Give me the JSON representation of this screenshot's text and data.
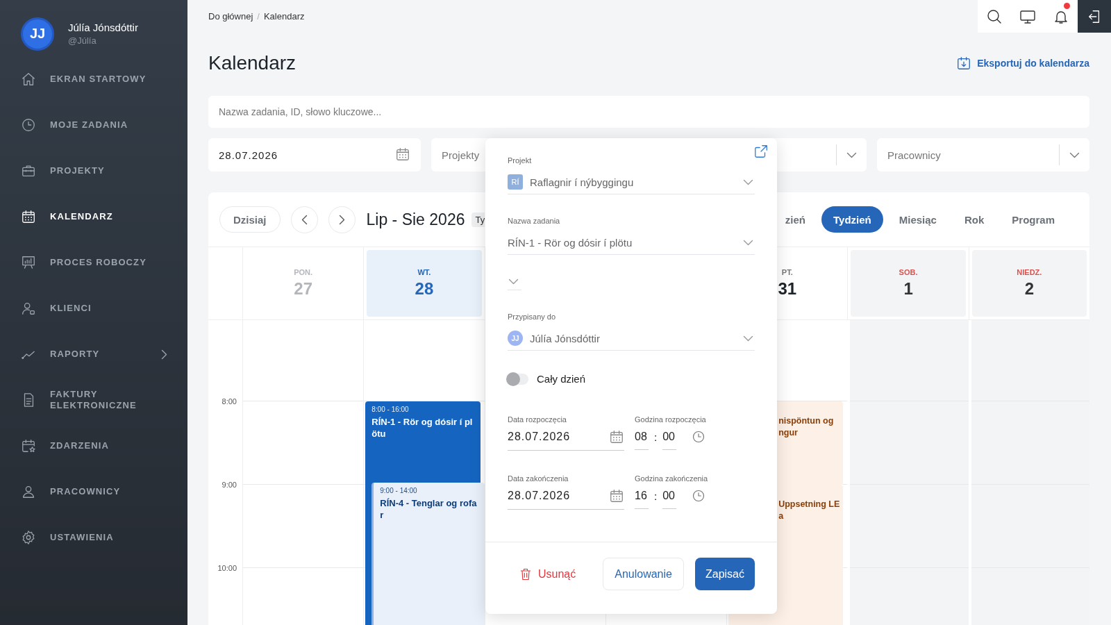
{
  "user": {
    "initials": "JJ",
    "name": "Júlía Jónsdóttir",
    "handle": "@Júlía"
  },
  "sidebar": {
    "items": [
      {
        "label": "EKRAN STARTOWY",
        "kind": "home",
        "selected": false,
        "has_submenu": false
      },
      {
        "label": "MOJE ZADANIA",
        "kind": "clock",
        "selected": false,
        "has_submenu": false
      },
      {
        "label": "PROJEKTY",
        "kind": "briefcase",
        "selected": false,
        "has_submenu": false
      },
      {
        "label": "KALENDARZ",
        "kind": "calendar",
        "selected": true,
        "has_submenu": false
      },
      {
        "label": "PROCES ROBOCZY",
        "kind": "board",
        "selected": false,
        "has_submenu": false
      },
      {
        "label": "KLIENCI",
        "kind": "client",
        "selected": false,
        "has_submenu": false
      },
      {
        "label": "RAPORTY",
        "kind": "chart",
        "selected": false,
        "has_submenu": true
      },
      {
        "label": "FAKTURY ELEKTRONICZNE",
        "kind": "document",
        "selected": false,
        "has_submenu": false
      },
      {
        "label": "ZDARZENIA",
        "kind": "event",
        "selected": false,
        "has_submenu": false
      },
      {
        "label": "PRACOWNICY",
        "kind": "people",
        "selected": false,
        "has_submenu": false
      },
      {
        "label": "USTAWIENIA",
        "kind": "gear",
        "selected": false,
        "has_submenu": false
      }
    ]
  },
  "breadcrumb": {
    "items": [
      "Do głównej",
      "Kalendarz"
    ],
    "separator": "/"
  },
  "topbar": {
    "notifications_unread": true
  },
  "page_title": "Kalendarz",
  "export_link": "Eksportuj do kalendarza",
  "search": {
    "placeholder": "Nazwa zadania, ID, słowo kluczowe..."
  },
  "filters": [
    {
      "kind": "date",
      "value": "28.07.2026"
    },
    {
      "kind": "label",
      "placeholder": "Projekty"
    },
    {
      "kind": "select"
    },
    {
      "kind": "select",
      "placeholder": "Pracownicy"
    }
  ],
  "calendar": {
    "today_button": "Dzisiaj",
    "range_title": "Lip - Sie 2026",
    "range_chip": "Ty",
    "views": [
      {
        "label": "zień",
        "selected": false
      },
      {
        "label": "Tydzień",
        "selected": true
      },
      {
        "label": "Miesiąc",
        "selected": false
      },
      {
        "label": "Rok",
        "selected": false
      },
      {
        "label": "Program",
        "selected": false
      }
    ],
    "hours": [
      "8:00",
      "9:00",
      "10:00"
    ],
    "days": [
      {
        "kind": "past",
        "weekday": "PON.",
        "date": "27"
      },
      {
        "kind": "today",
        "weekday": "WT.",
        "date": "28",
        "events": [
          {
            "kind": "primary",
            "time": "8:00 - 16:00",
            "title": "RÍN-1 - Rör og dósir í plötu",
            "children": [
              {
                "kind": "secondary",
                "time": "9:00 - 14:00",
                "title": "RÍN-4 - Tenglar og rofar"
              }
            ]
          }
        ]
      },
      {
        "kind": "covered"
      },
      {
        "kind": "covered"
      },
      {
        "kind": "normal",
        "weekday": "PT.",
        "date": "31",
        "events": [
          {
            "kind": "warm",
            "lines": [
              "nispöntun og",
              "ngur"
            ]
          },
          {
            "kind": "warm",
            "lines": [
              "Uppsetning LE",
              "a"
            ]
          }
        ]
      },
      {
        "kind": "weekend",
        "weekday": "SOB.",
        "date": "1"
      },
      {
        "kind": "weekend",
        "weekday": "NIEDZ.",
        "date": "2"
      }
    ]
  },
  "popup": {
    "fields": [
      {
        "kind": "select",
        "label": "Projekt",
        "value": "Raflagnir í nýbyggingu",
        "badge": "RÍ"
      },
      {
        "kind": "select",
        "label": "Nazwa zadania",
        "value": "RÍN-1 - Rör og dósir í plötu"
      },
      {
        "kind": "empty"
      },
      {
        "kind": "select",
        "label": "Przypisany do",
        "value": "Júlía Jónsdóttir",
        "avatar": "JJ"
      }
    ],
    "all_day": {
      "label": "Cały dzień",
      "on": false
    },
    "ranges": [
      {
        "date_label": "Data rozpoczęcia",
        "date": "28.07.2026",
        "time_label": "Godzina rozpoczęcia",
        "hour": "08",
        "separator": ":",
        "minute": "00"
      },
      {
        "date_label": "Data zakończenia",
        "date": "28.07.2026",
        "time_label": "Godzina zakończenia",
        "hour": "16",
        "separator": ":",
        "minute": "00"
      }
    ],
    "delete_button": "Usunąć",
    "cancel_button": "Anulowanie",
    "save_button": "Zapisać"
  }
}
